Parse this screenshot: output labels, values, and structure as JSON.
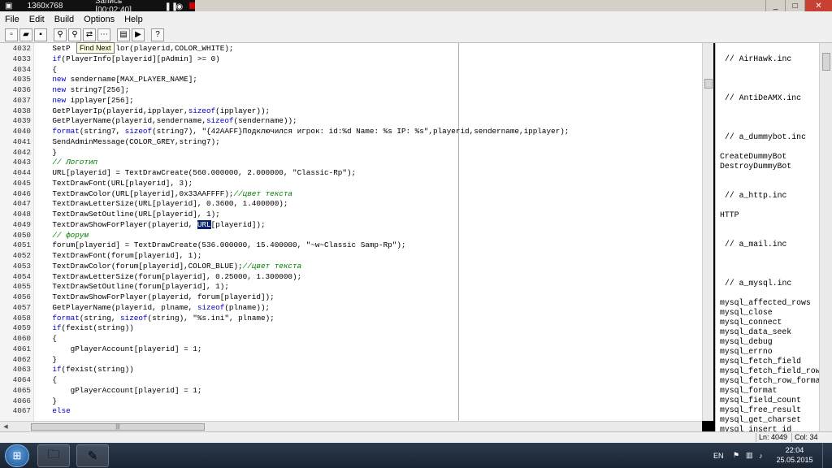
{
  "recorder": {
    "resolution": "1360x768",
    "status": "Запись [00:02:40]"
  },
  "menu": [
    "File",
    "Edit",
    "Build",
    "Options",
    "Help"
  ],
  "toolbar": {
    "tooltip": "Find Next",
    "buttons": [
      "new-file-icon",
      "open-folder-icon",
      "save-icon",
      "find-icon",
      "find-next-icon",
      "replace-icon",
      "goto-icon",
      "compile-icon",
      "run-icon",
      "help-icon"
    ]
  },
  "editor": {
    "lines": [
      {
        "n": "4032",
        "t": "    SetP          lor(playerid,COLOR_WHITE);"
      },
      {
        "n": "4033",
        "t": "    if(PlayerInfo[playerid][pAdmin] >= 0)"
      },
      {
        "n": "4034",
        "t": "    {"
      },
      {
        "n": "4035",
        "t": "    new sendername[MAX_PLAYER_NAME];"
      },
      {
        "n": "4036",
        "t": "    new string7[256];"
      },
      {
        "n": "4037",
        "t": "    new ipplayer[256];"
      },
      {
        "n": "4038",
        "t": "    GetPlayerIp(playerid,ipplayer,sizeof(ipplayer));"
      },
      {
        "n": "4039",
        "t": "    GetPlayerName(playerid,sendername,sizeof(sendername));"
      },
      {
        "n": "4040",
        "t": "    format(string7, sizeof(string7), \"{42AAFF}Подключился игрок: id:%d Name: %s IP: %s\",playerid,sendername,ipplayer);"
      },
      {
        "n": "4041",
        "t": "    SendAdminMessage(COLOR_GREY,string7);"
      },
      {
        "n": "4042",
        "t": "    }"
      },
      {
        "n": "4043",
        "t": "    // Логотип"
      },
      {
        "n": "4044",
        "t": "    URL[playerid] = TextDrawCreate(560.000000, 2.000000, \"Classic-Rp\");"
      },
      {
        "n": "4045",
        "t": "    TextDrawFont(URL[playerid], 3);"
      },
      {
        "n": "4046",
        "t": "    TextDrawColor(URL[playerid],0x33AAFFFF);//цвет текста"
      },
      {
        "n": "4047",
        "t": "    TextDrawLetterSize(URL[playerid], 0.3600, 1.400000);"
      },
      {
        "n": "4048",
        "t": "    TextDrawSetOutline(URL[playerid], 1);"
      },
      {
        "n": "4049",
        "t": "    TextDrawShowForPlayer(playerid, URL[playerid]);"
      },
      {
        "n": "4050",
        "t": "    // форум"
      },
      {
        "n": "4051",
        "t": "    forum[playerid] = TextDrawCreate(536.000000, 15.400000, \"~w~Classic Samp-Rp\");"
      },
      {
        "n": "4052",
        "t": "    TextDrawFont(forum[playerid], 1);"
      },
      {
        "n": "4053",
        "t": "    TextDrawColor(forum[playerid],COLOR_BLUE);//цвет текста"
      },
      {
        "n": "4054",
        "t": "    TextDrawLetterSize(forum[playerid], 0.25000, 1.300000);"
      },
      {
        "n": "4055",
        "t": "    TextDrawSetOutline(forum[playerid], 1);"
      },
      {
        "n": "4056",
        "t": "    TextDrawShowForPlayer(playerid, forum[playerid]);"
      },
      {
        "n": "4057",
        "t": "    GetPlayerName(playerid, plname, sizeof(plname));"
      },
      {
        "n": "4058",
        "t": "    format(string, sizeof(string), \"%s.ini\", plname);"
      },
      {
        "n": "4059",
        "t": "    if(fexist(string))"
      },
      {
        "n": "4060",
        "t": "    {"
      },
      {
        "n": "4061",
        "t": "        gPlayerAccount[playerid] = 1;"
      },
      {
        "n": "4062",
        "t": "    }"
      },
      {
        "n": "4063",
        "t": "    if(fexist(string))"
      },
      {
        "n": "4064",
        "t": "    {"
      },
      {
        "n": "4065",
        "t": "        gPlayerAccount[playerid] = 1;"
      },
      {
        "n": "4066",
        "t": "    }"
      },
      {
        "n": "4067",
        "t": "    else"
      }
    ],
    "selected_word": "URL"
  },
  "panel": {
    "items": [
      {
        "t": "// AirHawk.inc",
        "h": true
      },
      {
        "t": "// AntiDeAMX.inc",
        "h": true
      },
      {
        "t": "// a_dummybot.inc",
        "h": true
      },
      {
        "t": "CreateDummyBot",
        "h": false
      },
      {
        "t": "DestroyDummyBot",
        "h": false
      },
      {
        "t": "// a_http.inc",
        "h": true
      },
      {
        "t": "HTTP",
        "h": false
      },
      {
        "t": "// a_mail.inc",
        "h": true
      },
      {
        "t": "// a_mysql.inc",
        "h": true
      },
      {
        "t": "mysql_affected_rows",
        "h": false
      },
      {
        "t": "mysql_close",
        "h": false
      },
      {
        "t": "mysql_connect",
        "h": false
      },
      {
        "t": "mysql_data_seek",
        "h": false
      },
      {
        "t": "mysql_debug",
        "h": false
      },
      {
        "t": "mysql_errno",
        "h": false
      },
      {
        "t": "mysql_fetch_field",
        "h": false
      },
      {
        "t": "mysql_fetch_field_row",
        "h": false
      },
      {
        "t": "mysql_fetch_row_format",
        "h": false
      },
      {
        "t": "mysql_format",
        "h": false
      },
      {
        "t": "mysql_field_count",
        "h": false
      },
      {
        "t": "mysql_free_result",
        "h": false
      },
      {
        "t": "mysql_get_charset",
        "h": false
      },
      {
        "t": "mysql_insert_id",
        "h": false
      }
    ]
  },
  "status": {
    "line": "Ln: 4049",
    "col": "Col: 34"
  },
  "taskbar": {
    "lang": "EN",
    "time": "22:04",
    "date": "25.05.2015"
  }
}
